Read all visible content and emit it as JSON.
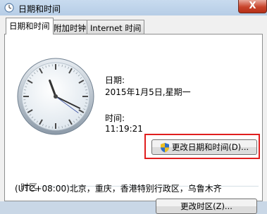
{
  "window": {
    "title": "日期和时间",
    "close_glyph": "X",
    "icon": "clock-icon"
  },
  "tabs": [
    {
      "label": "日期和时间",
      "active": true
    },
    {
      "label": "附加时钟",
      "active": false
    },
    {
      "label": "Internet 时间",
      "active": false
    }
  ],
  "datetime": {
    "date_label": "日期:",
    "date_value": "2015年1月5日,星期一",
    "time_label": "时间:",
    "time_value": "11:19:21",
    "change_button": "更改日期和时间(D)..."
  },
  "clock": {
    "hour": 11,
    "minute": 19,
    "second": 21
  },
  "timezone": {
    "section_title": "时区",
    "value": "(UTC+08:00)北京，重庆，香港特别行政区，乌鲁木齐",
    "change_button": "更改时区(Z)..."
  },
  "colors": {
    "highlight": "#e01e1e",
    "shield_blue": "#2f6fc7",
    "shield_yellow": "#f0c020"
  }
}
